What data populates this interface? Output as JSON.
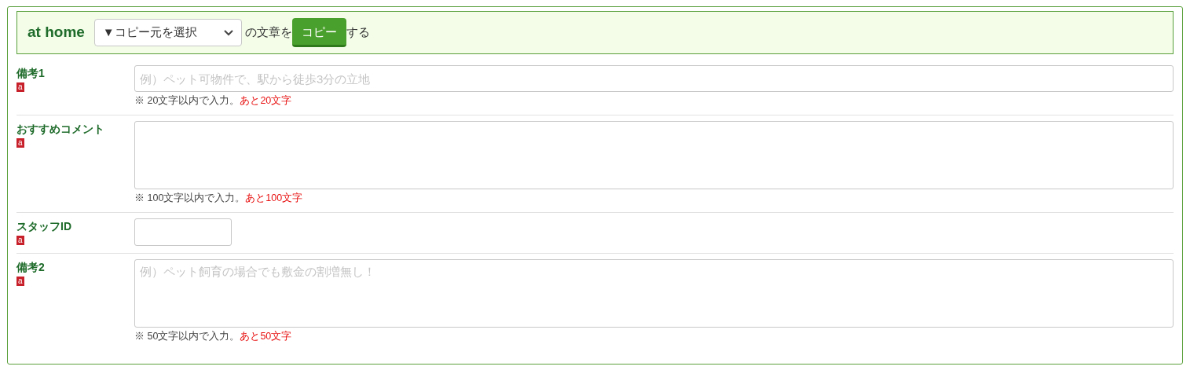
{
  "header": {
    "title": "at home",
    "select": {
      "value": "▼コピー元を選択"
    },
    "text_before": "の文章を",
    "button": "コピー",
    "text_after": "する"
  },
  "fields": [
    {
      "label": "備考1",
      "badge": "a",
      "kind": "text",
      "placeholder": "例）ペット可物件で、駅から徒歩3分の立地",
      "hint": "※ 20文字以内で入力。",
      "remaining": "あと20文字"
    },
    {
      "label": "おすすめコメント",
      "badge": "a",
      "kind": "textarea",
      "hint": "※ 100文字以内で入力。",
      "remaining": "あと100文字"
    },
    {
      "label": "スタッフID",
      "badge": "a",
      "kind": "short"
    },
    {
      "label": "備考2",
      "badge": "a",
      "kind": "textarea",
      "placeholder": "例）ペット飼育の場合でも敷金の割増無し！",
      "hint": "※ 50文字以内で入力。",
      "remaining": "あと50文字"
    }
  ]
}
